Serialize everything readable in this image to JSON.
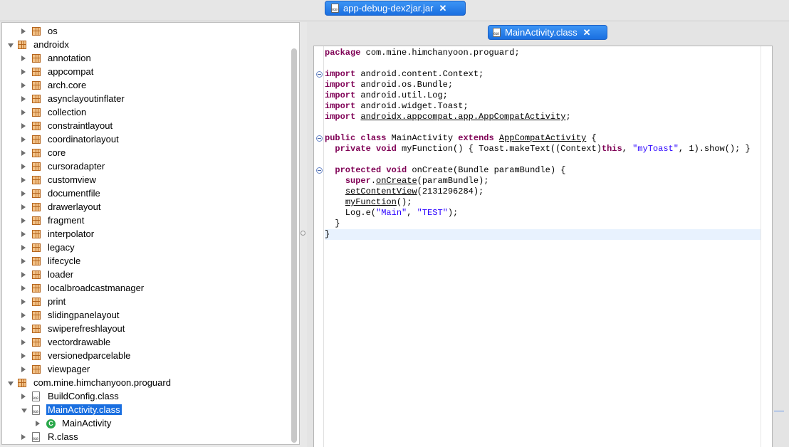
{
  "window": {
    "file_tab": {
      "label": "app-debug-dex2jar.jar",
      "close": "✕"
    }
  },
  "tree": {
    "items": [
      {
        "label": "os",
        "level": 1,
        "icon": "package-icon",
        "arrow": "right"
      },
      {
        "label": "androidx",
        "level": 0,
        "icon": "package-icon",
        "arrow": "down"
      },
      {
        "label": "annotation",
        "level": 1,
        "icon": "package-icon",
        "arrow": "right"
      },
      {
        "label": "appcompat",
        "level": 1,
        "icon": "package-icon",
        "arrow": "right"
      },
      {
        "label": "arch.core",
        "level": 1,
        "icon": "package-icon",
        "arrow": "right"
      },
      {
        "label": "asynclayoutinflater",
        "level": 1,
        "icon": "package-icon",
        "arrow": "right"
      },
      {
        "label": "collection",
        "level": 1,
        "icon": "package-icon",
        "arrow": "right"
      },
      {
        "label": "constraintlayout",
        "level": 1,
        "icon": "package-icon",
        "arrow": "right"
      },
      {
        "label": "coordinatorlayout",
        "level": 1,
        "icon": "package-icon",
        "arrow": "right"
      },
      {
        "label": "core",
        "level": 1,
        "icon": "package-icon",
        "arrow": "right"
      },
      {
        "label": "cursoradapter",
        "level": 1,
        "icon": "package-icon",
        "arrow": "right"
      },
      {
        "label": "customview",
        "level": 1,
        "icon": "package-icon",
        "arrow": "right"
      },
      {
        "label": "documentfile",
        "level": 1,
        "icon": "package-icon",
        "arrow": "right"
      },
      {
        "label": "drawerlayout",
        "level": 1,
        "icon": "package-icon",
        "arrow": "right"
      },
      {
        "label": "fragment",
        "level": 1,
        "icon": "package-icon",
        "arrow": "right"
      },
      {
        "label": "interpolator",
        "level": 1,
        "icon": "package-icon",
        "arrow": "right"
      },
      {
        "label": "legacy",
        "level": 1,
        "icon": "package-icon",
        "arrow": "right"
      },
      {
        "label": "lifecycle",
        "level": 1,
        "icon": "package-icon",
        "arrow": "right"
      },
      {
        "label": "loader",
        "level": 1,
        "icon": "package-icon",
        "arrow": "right"
      },
      {
        "label": "localbroadcastmanager",
        "level": 1,
        "icon": "package-icon",
        "arrow": "right"
      },
      {
        "label": "print",
        "level": 1,
        "icon": "package-icon",
        "arrow": "right"
      },
      {
        "label": "slidingpanelayout",
        "level": 1,
        "icon": "package-icon",
        "arrow": "right"
      },
      {
        "label": "swiperefreshlayout",
        "level": 1,
        "icon": "package-icon",
        "arrow": "right"
      },
      {
        "label": "vectordrawable",
        "level": 1,
        "icon": "package-icon",
        "arrow": "right"
      },
      {
        "label": "versionedparcelable",
        "level": 1,
        "icon": "package-icon",
        "arrow": "right"
      },
      {
        "label": "viewpager",
        "level": 1,
        "icon": "package-icon",
        "arrow": "right"
      },
      {
        "label": "com.mine.himchanyoon.proguard",
        "level": 0,
        "icon": "package-icon",
        "arrow": "down"
      },
      {
        "label": "BuildConfig.class",
        "level": 1,
        "icon": "class-file-icon",
        "arrow": "right"
      },
      {
        "label": "MainActivity.class",
        "level": 1,
        "icon": "class-file-icon",
        "arrow": "down",
        "selected": true
      },
      {
        "label": "MainActivity",
        "level": 2,
        "icon": "class-c-icon",
        "arrow": "right"
      },
      {
        "label": "R.class",
        "level": 1,
        "icon": "class-file-icon",
        "arrow": "right"
      }
    ]
  },
  "editor": {
    "tab": {
      "label": "MainActivity.class",
      "close": "✕"
    },
    "code_lines": [
      "package com.mine.himchanyoon.proguard;",
      "",
      "import android.content.Context;",
      "import android.os.Bundle;",
      "import android.util.Log;",
      "import android.widget.Toast;",
      "import androidx.appcompat.app.AppCompatActivity;",
      "",
      "public class MainActivity extends AppCompatActivity {",
      "  private void myFunction() { Toast.makeText((Context)this, \"myToast\", 1).show(); }",
      "",
      "  protected void onCreate(Bundle paramBundle) {",
      "    super.onCreate(paramBundle);",
      "    setContentView(2131296284);",
      "    myFunction();",
      "    Log.e(\"Main\", \"TEST\");",
      "  }",
      "}"
    ],
    "current_line": 18
  },
  "colors": {
    "accent": "#1a6fe0",
    "keyword": "#7f0055",
    "string": "#2a00ff",
    "current_line": "#e8f2fe"
  }
}
